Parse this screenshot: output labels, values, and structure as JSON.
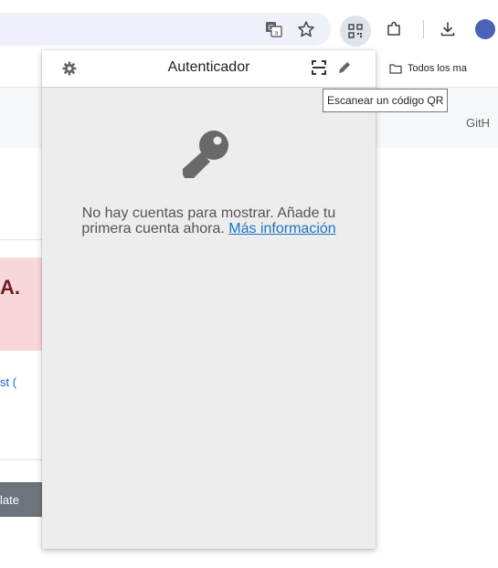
{
  "browser": {
    "bookmarks": {
      "all_bookmarks_label": "Todos los ma"
    },
    "icons": [
      "translate-icon",
      "star-icon",
      "qr-extension-icon",
      "extensions-icon",
      "download-icon",
      "profile-avatar"
    ]
  },
  "page": {
    "github_text": "GitH",
    "alert_text": "A.",
    "link_text": "st (",
    "button_text": "late"
  },
  "popup": {
    "title": "Autenticador",
    "message": "No hay cuentas para mostrar. Añade tu primera cuenta ahora.",
    "more_info_link": "Más información",
    "icons": [
      "gear-icon",
      "scan-qr-icon",
      "pencil-icon",
      "key-icon"
    ]
  },
  "tooltip": {
    "text": "Escanear un código QR"
  },
  "colors": {
    "popup_bg": "#ededed",
    "link": "#1a73c8",
    "icon_gray": "#666666",
    "alert_bg": "#f8d7da",
    "alert_text": "#721c24"
  }
}
